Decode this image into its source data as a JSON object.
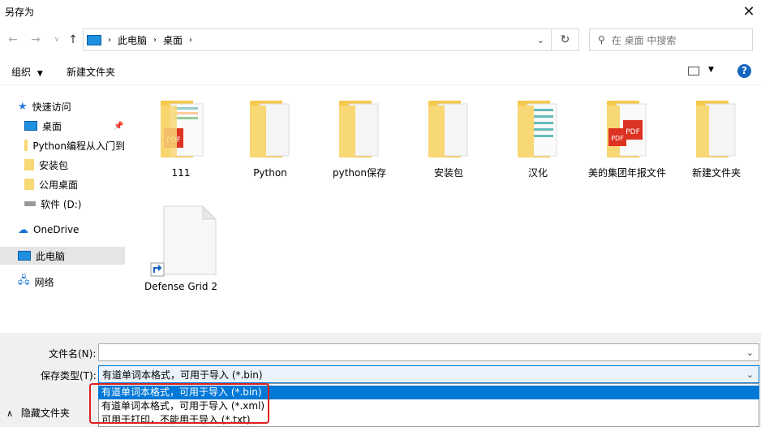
{
  "window": {
    "title": "另存为"
  },
  "nav": {
    "address": [
      "此电脑",
      "桌面"
    ],
    "search_placeholder": "在 桌面 中搜索"
  },
  "cmd": {
    "organize": "组织",
    "new_folder": "新建文件夹"
  },
  "sidebar": {
    "items": [
      {
        "label": "快速访问"
      },
      {
        "label": "桌面"
      },
      {
        "label": "Python编程从入门到"
      },
      {
        "label": "安装包"
      },
      {
        "label": "公用桌面"
      },
      {
        "label": "软件 (D:)"
      },
      {
        "label": "OneDrive"
      },
      {
        "label": "此电脑"
      },
      {
        "label": "网络"
      }
    ]
  },
  "files": [
    {
      "label": "111"
    },
    {
      "label": "Python"
    },
    {
      "label": "python保存"
    },
    {
      "label": "安装包"
    },
    {
      "label": "汉化"
    },
    {
      "label": "美的集团年报文件"
    },
    {
      "label": "新建文件夹"
    },
    {
      "label": "Defense Grid 2"
    }
  ],
  "form": {
    "filename_label": "文件名(N):",
    "filename_value": "",
    "type_label": "保存类型(T):",
    "type_value": "有道单词本格式，可用于导入 (*.bin)",
    "options": [
      "有道单词本格式，可用于导入 (*.bin)",
      "有道单词本格式，可用于导入 (*.xml)",
      "可用于打印，不能用于导入 (*.txt)"
    ],
    "hide_folders": "隐藏文件夹"
  },
  "colors": {
    "accent": "#0078d7",
    "highlight_border": "#e0201c",
    "folder": "#f8d775"
  }
}
